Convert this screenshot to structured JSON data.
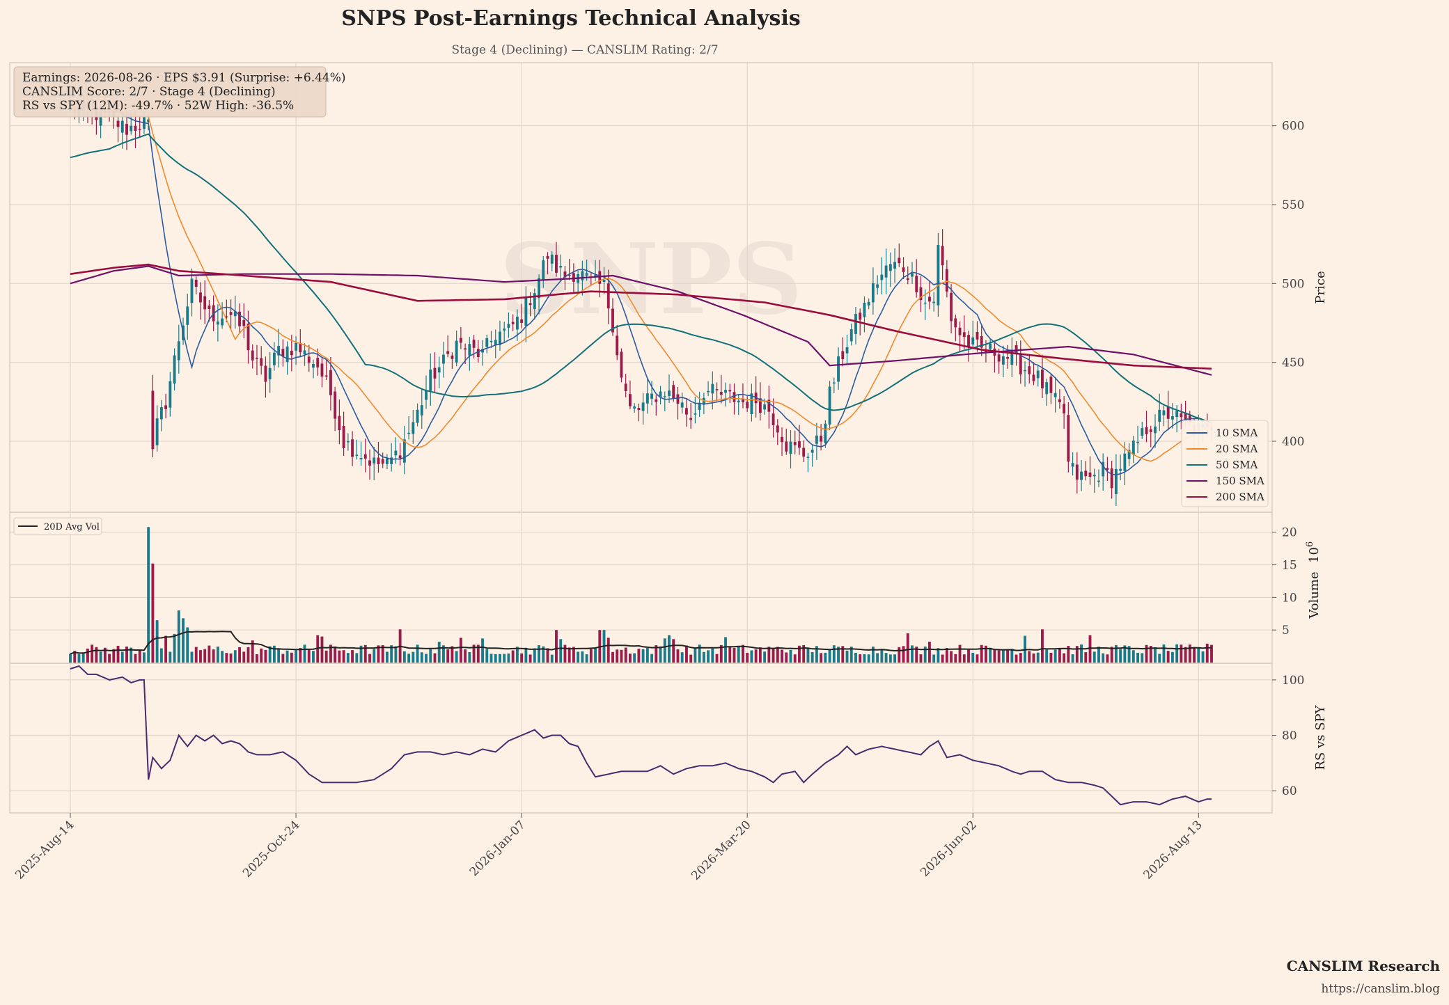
{
  "title": "SNPS Post-Earnings Technical Analysis",
  "subtitle": "Stage 4 (Declining) — CANSLIM Rating: 2/7",
  "watermark": "SNPS",
  "info_box": [
    "Earnings: 2026-08-26 · EPS $3.91 (Surprise: +6.44%)",
    "CANSLIM Score: 2/7 · Stage 4 (Declining)",
    "RS vs SPY (12M): -49.7% · 52W High: -36.5%"
  ],
  "footer": {
    "brand": "CANSLIM Research",
    "url": "https://canslim.blog"
  },
  "colors": {
    "background": "#fdf1e6",
    "up": "#1a7a8a",
    "down": "#9b1b4a",
    "sma10": "#2a5aa0",
    "sma20": "#f08a2c",
    "sma50": "#127078",
    "sma150": "#6e1068",
    "sma200": "#9b0d3e",
    "avgvol": "#222222",
    "rs": "#4a2a6e",
    "grid": "#e2d6cc"
  },
  "chart_data": {
    "type": "candlestick",
    "x_ticks": [
      "2025-Aug-14",
      "2025-Oct-24",
      "2026-Jan-07",
      "2026-Mar-20",
      "2026-Jun-02",
      "2026-Aug-13"
    ],
    "trading_days": 264,
    "price_panel": {
      "ylabel": "Price",
      "yticks": [
        400,
        450,
        500,
        550,
        600
      ],
      "ylim": [
        355,
        640
      ],
      "legend": [
        "10 SMA",
        "20 SMA",
        "50 SMA",
        "150 SMA",
        "200 SMA"
      ],
      "close_anchors": [
        [
          0,
          612
        ],
        [
          8,
          606
        ],
        [
          13,
          598
        ],
        [
          17,
          602
        ],
        [
          18,
          604
        ],
        [
          19,
          395
        ],
        [
          20,
          410
        ],
        [
          22,
          425
        ],
        [
          25,
          465
        ],
        [
          28,
          498
        ],
        [
          32,
          480
        ],
        [
          37,
          480
        ],
        [
          40,
          470
        ],
        [
          42,
          452
        ],
        [
          45,
          440
        ],
        [
          48,
          458
        ],
        [
          52,
          460
        ],
        [
          57,
          448
        ],
        [
          60,
          430
        ],
        [
          63,
          400
        ],
        [
          67,
          392
        ],
        [
          70,
          386
        ],
        [
          73,
          385
        ],
        [
          76,
          395
        ],
        [
          78,
          406
        ],
        [
          80,
          418
        ],
        [
          83,
          440
        ],
        [
          86,
          450
        ],
        [
          89,
          462
        ],
        [
          92,
          458
        ],
        [
          95,
          455
        ],
        [
          98,
          468
        ],
        [
          101,
          470
        ],
        [
          104,
          480
        ],
        [
          107,
          497
        ],
        [
          110,
          518
        ],
        [
          112,
          510
        ],
        [
          114,
          505
        ],
        [
          117,
          508
        ],
        [
          120,
          500
        ],
        [
          123,
          498
        ],
        [
          125,
          475
        ],
        [
          127,
          440
        ],
        [
          129,
          420
        ],
        [
          131,
          420
        ],
        [
          134,
          428
        ],
        [
          137,
          432
        ],
        [
          140,
          426
        ],
        [
          143,
          415
        ],
        [
          146,
          432
        ],
        [
          149,
          430
        ],
        [
          152,
          428
        ],
        [
          155,
          425
        ],
        [
          158,
          426
        ],
        [
          161,
          420
        ],
        [
          163,
          410
        ],
        [
          165,
          398
        ],
        [
          167,
          395
        ],
        [
          169,
          392
        ],
        [
          171,
          395
        ],
        [
          173,
          402
        ],
        [
          175,
          430
        ],
        [
          177,
          448
        ],
        [
          180,
          470
        ],
        [
          183,
          485
        ],
        [
          186,
          502
        ],
        [
          189,
          512
        ],
        [
          192,
          510
        ],
        [
          195,
          500
        ],
        [
          197,
          488
        ],
        [
          199,
          490
        ],
        [
          200,
          522
        ],
        [
          201,
          510
        ],
        [
          203,
          478
        ],
        [
          205,
          468
        ],
        [
          207,
          462
        ],
        [
          210,
          458
        ],
        [
          213,
          457
        ],
        [
          215,
          455
        ],
        [
          217,
          452
        ],
        [
          220,
          446
        ],
        [
          223,
          440
        ],
        [
          226,
          428
        ],
        [
          229,
          418
        ],
        [
          230,
          385
        ],
        [
          232,
          378
        ],
        [
          235,
          376
        ],
        [
          238,
          382
        ],
        [
          240,
          376
        ],
        [
          242,
          385
        ],
        [
          245,
          395
        ],
        [
          248,
          408
        ],
        [
          251,
          415
        ],
        [
          254,
          418
        ],
        [
          256,
          412
        ],
        [
          259,
          408
        ],
        [
          262,
          406
        ],
        [
          263,
          410
        ]
      ],
      "earnings_gap": {
        "from_index": 18,
        "to_index": 19,
        "before": 604,
        "after": 395
      },
      "sma150_anchors": [
        [
          0,
          500
        ],
        [
          10,
          508
        ],
        [
          18,
          511
        ],
        [
          25,
          505
        ],
        [
          40,
          506
        ],
        [
          60,
          506
        ],
        [
          80,
          505
        ],
        [
          100,
          501
        ],
        [
          115,
          503
        ],
        [
          125,
          505
        ],
        [
          140,
          495
        ],
        [
          155,
          480
        ],
        [
          170,
          463
        ],
        [
          175,
          448
        ],
        [
          190,
          451
        ],
        [
          210,
          456
        ],
        [
          230,
          460
        ],
        [
          245,
          455
        ],
        [
          263,
          442
        ]
      ],
      "sma200_anchors": [
        [
          0,
          506
        ],
        [
          10,
          510
        ],
        [
          18,
          512
        ],
        [
          25,
          508
        ],
        [
          40,
          505
        ],
        [
          60,
          501
        ],
        [
          80,
          489
        ],
        [
          100,
          490
        ],
        [
          120,
          495
        ],
        [
          140,
          493
        ],
        [
          160,
          488
        ],
        [
          175,
          480
        ],
        [
          190,
          470
        ],
        [
          210,
          458
        ],
        [
          230,
          452
        ],
        [
          245,
          448
        ],
        [
          263,
          446
        ]
      ]
    },
    "volume_panel": {
      "ylabel": "Volume",
      "unit": "10^6",
      "yticks": [
        5,
        10,
        15,
        20
      ],
      "ylim": [
        0,
        22
      ],
      "legend": [
        "20D Avg Vol"
      ],
      "spikes": [
        [
          18,
          20.8
        ],
        [
          19,
          15.2
        ],
        [
          20,
          6.5
        ],
        [
          22,
          4.1
        ],
        [
          24,
          4.4
        ],
        [
          25,
          8.0
        ],
        [
          26,
          6.8
        ],
        [
          27,
          5.4
        ],
        [
          42,
          3.4
        ],
        [
          57,
          4.2
        ],
        [
          58,
          4.0
        ],
        [
          76,
          5.1
        ],
        [
          85,
          3.2
        ],
        [
          90,
          3.8
        ],
        [
          95,
          3.7
        ],
        [
          112,
          5.0
        ],
        [
          113,
          3.6
        ],
        [
          122,
          5.0
        ],
        [
          123,
          5.0
        ],
        [
          124,
          3.8
        ],
        [
          137,
          3.7
        ],
        [
          138,
          4.2
        ],
        [
          139,
          3.6
        ],
        [
          151,
          3.9
        ],
        [
          193,
          4.5
        ],
        [
          198,
          3.2
        ],
        [
          220,
          4.1
        ],
        [
          224,
          5.1
        ],
        [
          235,
          4.2
        ],
        [
          262,
          2.9
        ]
      ]
    },
    "rs_panel": {
      "ylabel": "RS vs SPY",
      "yticks": [
        60,
        80,
        100
      ],
      "ylim": [
        52,
        106
      ],
      "anchors": [
        [
          0,
          104
        ],
        [
          2,
          105
        ],
        [
          4,
          102
        ],
        [
          6,
          102
        ],
        [
          9,
          100
        ],
        [
          12,
          101
        ],
        [
          14,
          99
        ],
        [
          16,
          100
        ],
        [
          17,
          100
        ],
        [
          18,
          64
        ],
        [
          19,
          72
        ],
        [
          21,
          68
        ],
        [
          23,
          71
        ],
        [
          25,
          80
        ],
        [
          27,
          76
        ],
        [
          29,
          80
        ],
        [
          31,
          78
        ],
        [
          33,
          80
        ],
        [
          35,
          77
        ],
        [
          37,
          78
        ],
        [
          39,
          77
        ],
        [
          41,
          74
        ],
        [
          43,
          73
        ],
        [
          46,
          73
        ],
        [
          49,
          74
        ],
        [
          52,
          71
        ],
        [
          55,
          66
        ],
        [
          58,
          63
        ],
        [
          62,
          63
        ],
        [
          66,
          63
        ],
        [
          70,
          64
        ],
        [
          74,
          68
        ],
        [
          77,
          73
        ],
        [
          80,
          74
        ],
        [
          83,
          74
        ],
        [
          86,
          73
        ],
        [
          89,
          74
        ],
        [
          92,
          73
        ],
        [
          95,
          75
        ],
        [
          98,
          74
        ],
        [
          101,
          78
        ],
        [
          104,
          80
        ],
        [
          107,
          82
        ],
        [
          109,
          79
        ],
        [
          111,
          80
        ],
        [
          113,
          80
        ],
        [
          115,
          77
        ],
        [
          117,
          76
        ],
        [
          119,
          70
        ],
        [
          121,
          65
        ],
        [
          124,
          66
        ],
        [
          127,
          67
        ],
        [
          130,
          67
        ],
        [
          133,
          67
        ],
        [
          136,
          69
        ],
        [
          139,
          66
        ],
        [
          142,
          68
        ],
        [
          145,
          69
        ],
        [
          148,
          69
        ],
        [
          151,
          70
        ],
        [
          154,
          68
        ],
        [
          157,
          67
        ],
        [
          160,
          65
        ],
        [
          162,
          63
        ],
        [
          164,
          66
        ],
        [
          167,
          67
        ],
        [
          169,
          63
        ],
        [
          171,
          66
        ],
        [
          174,
          70
        ],
        [
          177,
          73
        ],
        [
          179,
          76
        ],
        [
          181,
          73
        ],
        [
          184,
          75
        ],
        [
          187,
          76
        ],
        [
          190,
          75
        ],
        [
          193,
          74
        ],
        [
          196,
          73
        ],
        [
          198,
          76
        ],
        [
          200,
          78
        ],
        [
          202,
          72
        ],
        [
          205,
          73
        ],
        [
          208,
          71
        ],
        [
          211,
          70
        ],
        [
          214,
          69
        ],
        [
          217,
          67
        ],
        [
          219,
          66
        ],
        [
          221,
          67
        ],
        [
          224,
          67
        ],
        [
          227,
          64
        ],
        [
          230,
          63
        ],
        [
          233,
          63
        ],
        [
          236,
          62
        ],
        [
          238,
          61
        ],
        [
          240,
          58
        ],
        [
          242,
          55
        ],
        [
          245,
          56
        ],
        [
          248,
          56
        ],
        [
          251,
          55
        ],
        [
          254,
          57
        ],
        [
          257,
          58
        ],
        [
          260,
          56
        ],
        [
          262,
          57
        ],
        [
          263,
          57
        ]
      ]
    }
  }
}
